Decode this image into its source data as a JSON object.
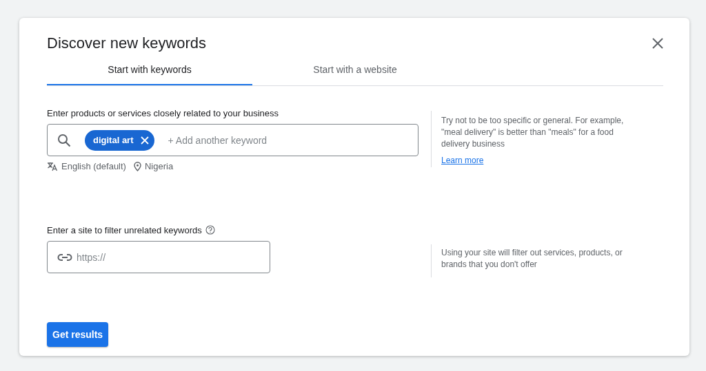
{
  "dialog": {
    "title": "Discover new keywords"
  },
  "tabs": [
    {
      "label": "Start with keywords",
      "selected": true
    },
    {
      "label": "Start with a website",
      "selected": false
    }
  ],
  "keywords_section": {
    "label": "Enter products or services closely related to your business",
    "chips": [
      "digital art"
    ],
    "placeholder": "+ Add another keyword",
    "language": "English (default)",
    "location": "Nigeria",
    "hint": "Try not to be too specific or general. For example, \"meal delivery\" is better than \"meals\" for a food delivery business",
    "link": "Learn more"
  },
  "site_section": {
    "label": "Enter a site to filter unrelated keywords",
    "placeholder": "https://",
    "hint": "Using your site will filter out services, products, or brands that you don't offer"
  },
  "buttons": [
    "Get results"
  ]
}
